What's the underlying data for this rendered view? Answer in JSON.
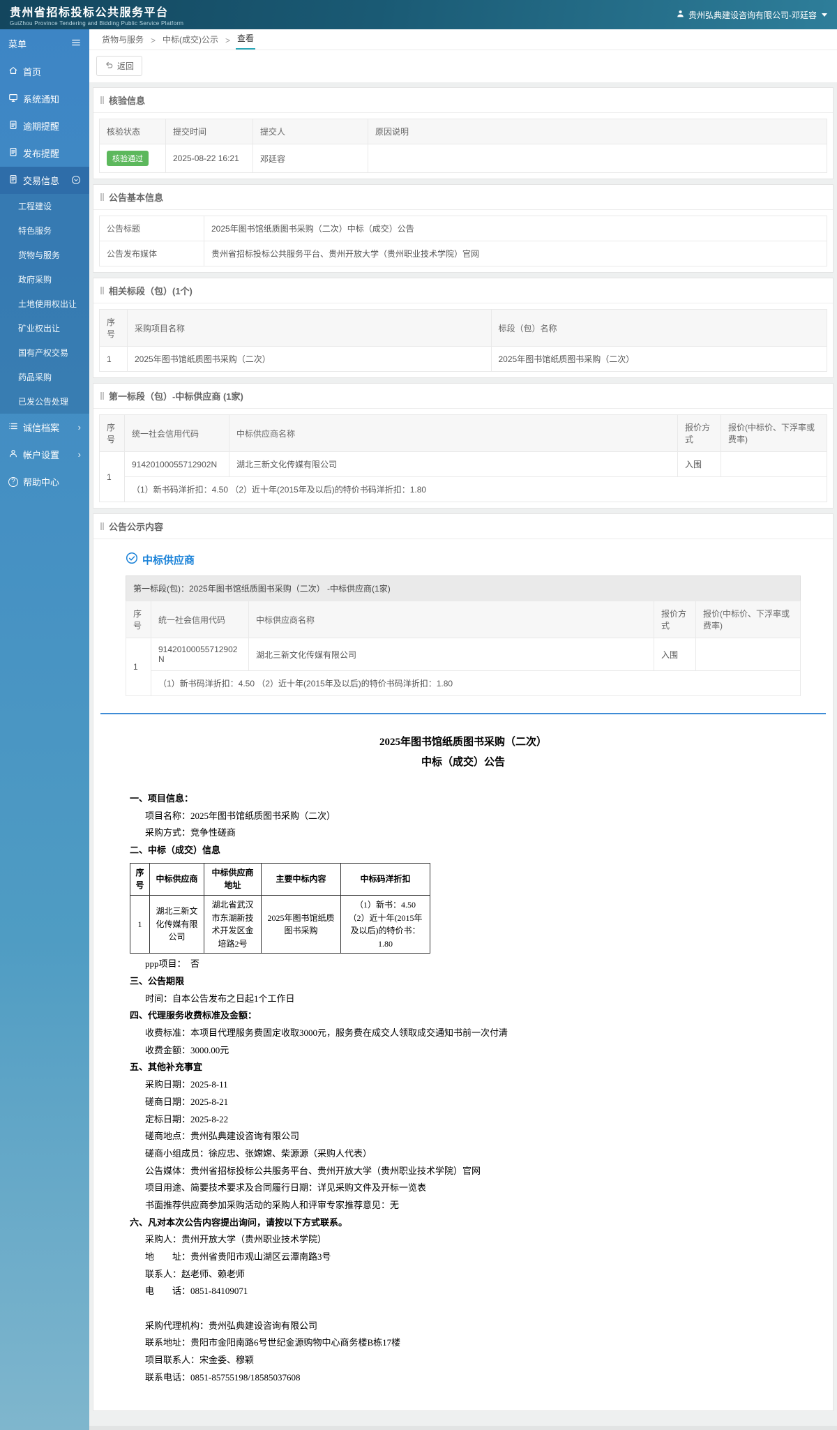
{
  "header": {
    "title": "贵州省招标投标公共服务平台",
    "subtitle": "GuiZhou Province Tendering and Bidding Public Service Platform",
    "user": "贵州弘典建设咨询有限公司-邓廷容"
  },
  "sidebar": {
    "menu_label": "菜单",
    "items": [
      {
        "label": "首页"
      },
      {
        "label": "系统通知"
      },
      {
        "label": "逾期提醒"
      },
      {
        "label": "发布提醒"
      },
      {
        "label": "交易信息"
      }
    ],
    "submenu": [
      "工程建设",
      "特色服务",
      "货物与服务",
      "政府采购",
      "土地使用权出让",
      "矿业权出让",
      "国有产权交易",
      "药品采购",
      "已发公告处理"
    ],
    "tail_items": [
      {
        "label": "诚信档案",
        "chevron": "›"
      },
      {
        "label": "帐户设置",
        "chevron": "›"
      },
      {
        "label": "帮助中心"
      }
    ],
    "help_glyph": "?"
  },
  "breadcrumb": {
    "separator": ">",
    "items": [
      "货物与服务",
      "中标(成交)公示",
      "查看"
    ]
  },
  "toolbar": {
    "back_label": "返回"
  },
  "verify": {
    "title": "核验信息",
    "headers": [
      "核验状态",
      "提交时间",
      "提交人",
      "原因说明"
    ],
    "row": {
      "status": "核验通过",
      "time": "2025-08-22 16:21",
      "person": "邓廷容",
      "reason": ""
    }
  },
  "basic": {
    "title": "公告基本信息",
    "rows": [
      {
        "label": "公告标题",
        "value": "2025年图书馆纸质图书采购（二次）中标（成交）公告"
      },
      {
        "label": "公告发布媒体",
        "value": "贵州省招标投标公共服务平台、贵州开放大学（贵州职业技术学院）官网"
      }
    ]
  },
  "related": {
    "title": "相关标段（包）(1个)",
    "headers": [
      "序号",
      "采购项目名称",
      "标段（包）名称"
    ],
    "row": {
      "no": "1",
      "project": "2025年图书馆纸质图书采购（二次）",
      "section": "2025年图书馆纸质图书采购（二次）"
    }
  },
  "winner": {
    "title": "第一标段（包）-中标供应商 (1家)",
    "headers": [
      "序号",
      "统一社会信用代码",
      "中标供应商名称",
      "报价方式",
      "报价(中标价、下浮率或费率)"
    ],
    "row": {
      "no": "1",
      "code": "91420100055712902N",
      "name": "湖北三新文化传媒有限公司",
      "method": "入围",
      "price": "",
      "note": "（1）新书码洋折扣：4.50 （2）近十年(2015年及以后)的特价书码洋折扣：1.80"
    }
  },
  "notice": {
    "title": "公告公示内容",
    "winner_heading": "中标供应商",
    "caption": "第一标段(包)：2025年图书馆纸质图书采购（二次） -中标供应商(1家)",
    "headers": [
      "序号",
      "统一社会信用代码",
      "中标供应商名称",
      "报价方式",
      "报价(中标价、下浮率或费率)"
    ],
    "row": {
      "no": "1",
      "code": "91420100055712902N",
      "name": "湖北三新文化传媒有限公司",
      "method": "入围",
      "price": "",
      "note": "（1）新书码洋折扣：4.50 （2）近十年(2015年及以后)的特价书码洋折扣：1.80"
    },
    "doc": {
      "title1": "2025年图书馆纸质图书采购（二次）",
      "title2": "中标（成交）公告",
      "s1": {
        "heading": "一、项目信息：",
        "lines": [
          "项目名称：2025年图书馆纸质图书采购（二次）",
          "采购方式：竞争性磋商"
        ]
      },
      "s2": {
        "heading": "二、中标（成交）信息"
      },
      "award_table": {
        "headers": [
          "序号",
          "中标供应商",
          "中标供应商地址",
          "主要中标内容",
          "中标码洋折扣"
        ],
        "row": {
          "no": "1",
          "supplier": "湖北三新文化传媒有限公司",
          "address": "湖北省武汉市东湖新技术开发区金培路2号",
          "content": "2025年图书馆纸质图书采购",
          "discount": "（1）新书：4.50\n（2）近十年(2015年及以后)的特价书：1.80"
        }
      },
      "ppp_line": "ppp项目：　否",
      "s3": {
        "heading": "三、公告期限",
        "lines": [
          "时间：自本公告发布之日起1个工作日"
        ]
      },
      "s4": {
        "heading": "四、代理服务收费标准及金额：",
        "lines": [
          "收费标准：本项目代理服务费固定收取3000元，服务费在成交人领取成交通知书前一次付清",
          "收费金额：3000.00元"
        ]
      },
      "s5": {
        "heading": "五、其他补充事宜",
        "lines": [
          "采购日期：2025-8-11",
          "磋商日期：2025-8-21",
          "定标日期：2025-8-22",
          "磋商地点：贵州弘典建设咨询有限公司",
          "磋商小组成员：徐应忠、张嫦嫦、柴源源（采购人代表）",
          "公告媒体：贵州省招标投标公共服务平台、贵州开放大学（贵州职业技术学院）官网",
          "项目用途、简要技术要求及合同履行日期：详见采购文件及开标一览表",
          "书面推荐供应商参加采购活动的采购人和评审专家推荐意见：无"
        ]
      },
      "s6": {
        "heading": "六、凡对本次公告内容提出询问，请按以下方式联系。",
        "lines": [
          "采购人：贵州开放大学（贵州职业技术学院）",
          "地　　址：贵州省贵阳市观山湖区云潭南路3号",
          "联系人：赵老师、赖老师",
          "电　　话：0851-84109071",
          " ",
          "采购代理机构：贵州弘典建设咨询有限公司",
          "联系地址：贵阳市金阳南路6号世纪金源购物中心商务楼B栋17楼",
          "项目联系人：宋金委、穆颖",
          "联系电话：0851-85755198/18585037608"
        ]
      }
    }
  },
  "colors": {
    "badge_green": "#5cb85c",
    "accent_blue": "#1a82d8",
    "rule_blue": "#3f8cd6"
  }
}
